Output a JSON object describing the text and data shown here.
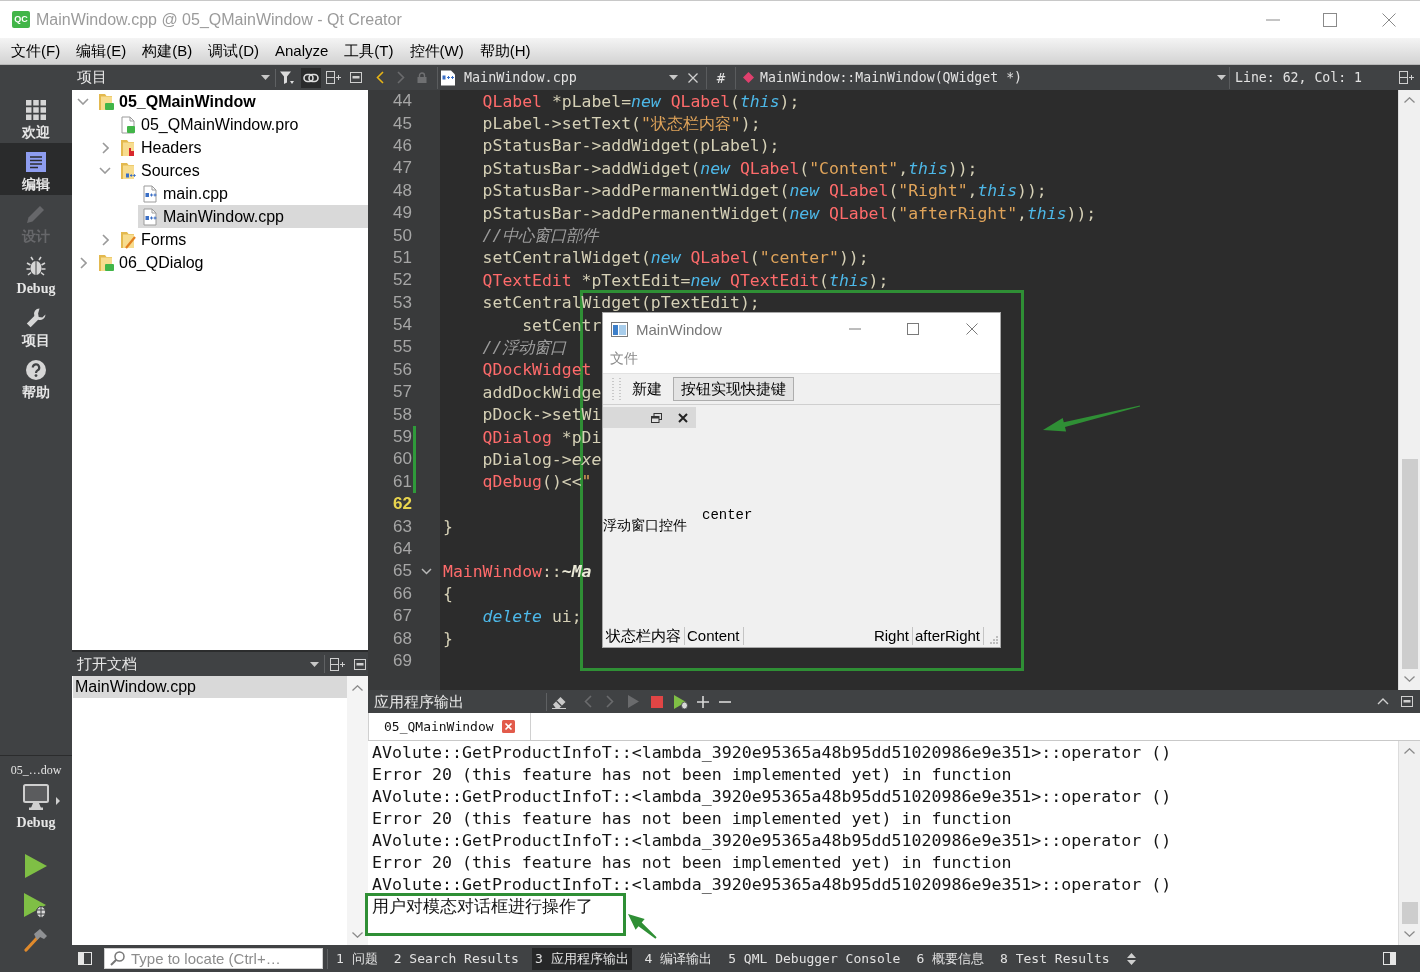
{
  "window": {
    "logo": "QC",
    "title": "MainWindow.cpp @ 05_QMainWindow - Qt Creator"
  },
  "menu_bar": [
    "文件(F)",
    "编辑(E)",
    "构建(B)",
    "调试(D)",
    "Analyze",
    "工具(T)",
    "控件(W)",
    "帮助(H)"
  ],
  "mode_bar": {
    "items": [
      {
        "kind": "grid",
        "label": "欢迎",
        "selected": false,
        "disabled": false
      },
      {
        "kind": "document",
        "label": "编辑",
        "selected": true,
        "disabled": false
      },
      {
        "kind": "pencil",
        "label": "设计",
        "selected": false,
        "disabled": true
      },
      {
        "kind": "bug",
        "label": "Debug",
        "selected": false,
        "disabled": false
      },
      {
        "kind": "wrench",
        "label": "项目",
        "selected": false,
        "disabled": false
      },
      {
        "kind": "help",
        "label": "帮助",
        "selected": false,
        "disabled": false
      }
    ],
    "target": {
      "project": "05_…dow",
      "config": "Debug"
    }
  },
  "projects_panel": {
    "title": "项目",
    "synchronize": true,
    "tree": [
      {
        "label": "05_QMainWindow",
        "kind": "project",
        "active": true,
        "expanded": true,
        "selected": false,
        "children": [
          {
            "label": "05_QMainWindow.pro",
            "kind": "profile",
            "selected": false
          },
          {
            "label": "Headers",
            "kind": "headers",
            "expanded": false,
            "selected": false
          },
          {
            "label": "Sources",
            "kind": "sources",
            "expanded": true,
            "selected": false,
            "children": [
              {
                "label": "main.cpp",
                "kind": "cppfile",
                "selected": false
              },
              {
                "label": "MainWindow.cpp",
                "kind": "cppfile",
                "selected": true
              }
            ]
          },
          {
            "label": "Forms",
            "kind": "forms",
            "expanded": false,
            "selected": false
          }
        ]
      },
      {
        "label": "06_QDialog",
        "kind": "project",
        "active": false,
        "expanded": false,
        "selected": false
      }
    ]
  },
  "open_documents": {
    "title": "打开文档",
    "items": [
      {
        "label": "MainWindow.cpp",
        "selected": true
      }
    ]
  },
  "editor": {
    "can_go_back": true,
    "can_go_forward": false,
    "file": "MainWindow.cpp",
    "hash": "#",
    "symbol": "MainWindow::MainWindow(QWidget *)",
    "position": "Line: 62, Col: 1",
    "lines": [
      {
        "number": "44",
        "current": false,
        "modified": false,
        "fold": false,
        "tokens": [
          {
            "kind": "type",
            "text": "    QLabel"
          },
          {
            "kind": "plain",
            "text": " *pLabel="
          },
          {
            "kind": "keyword",
            "text": "new "
          },
          {
            "kind": "type",
            "text": "QLabel"
          },
          {
            "kind": "plain",
            "text": "("
          },
          {
            "kind": "keyword",
            "text": "this"
          },
          {
            "kind": "plain",
            "text": ");"
          }
        ]
      },
      {
        "number": "45",
        "current": false,
        "modified": false,
        "fold": false,
        "tokens": [
          {
            "kind": "plain",
            "text": "    pLabel->setText("
          },
          {
            "kind": "string",
            "text": "\"状态栏内容\""
          },
          {
            "kind": "plain",
            "text": ");"
          }
        ]
      },
      {
        "number": "46",
        "current": false,
        "modified": false,
        "fold": false,
        "tokens": [
          {
            "kind": "plain",
            "text": "    pStatusBar->addWidget(pLabel);"
          }
        ]
      },
      {
        "number": "47",
        "current": false,
        "modified": false,
        "fold": false,
        "tokens": [
          {
            "kind": "plain",
            "text": "    pStatusBar->addWidget("
          },
          {
            "kind": "keyword",
            "text": "new "
          },
          {
            "kind": "type",
            "text": "QLabel"
          },
          {
            "kind": "plain",
            "text": "("
          },
          {
            "kind": "string",
            "text": "\"Content\""
          },
          {
            "kind": "plain",
            "text": ","
          },
          {
            "kind": "keyword",
            "text": "this"
          },
          {
            "kind": "plain",
            "text": "));"
          }
        ]
      },
      {
        "number": "48",
        "current": false,
        "modified": false,
        "fold": false,
        "tokens": [
          {
            "kind": "plain",
            "text": "    pStatusBar->addPermanentWidget("
          },
          {
            "kind": "keyword",
            "text": "new "
          },
          {
            "kind": "type",
            "text": "QLabel"
          },
          {
            "kind": "plain",
            "text": "("
          },
          {
            "kind": "string",
            "text": "\"Right\""
          },
          {
            "kind": "plain",
            "text": ","
          },
          {
            "kind": "keyword",
            "text": "this"
          },
          {
            "kind": "plain",
            "text": "));"
          }
        ]
      },
      {
        "number": "49",
        "current": false,
        "modified": false,
        "fold": false,
        "tokens": [
          {
            "kind": "plain",
            "text": "    pStatusBar->addPermanentWidget("
          },
          {
            "kind": "keyword",
            "text": "new "
          },
          {
            "kind": "type",
            "text": "QLabel"
          },
          {
            "kind": "plain",
            "text": "("
          },
          {
            "kind": "string",
            "text": "\"afterRight\""
          },
          {
            "kind": "plain",
            "text": ","
          },
          {
            "kind": "keyword",
            "text": "this"
          },
          {
            "kind": "plain",
            "text": "));"
          }
        ]
      },
      {
        "number": "50",
        "current": false,
        "modified": false,
        "fold": false,
        "tokens": [
          {
            "kind": "comment",
            "text": "    //中心窗口部件"
          }
        ]
      },
      {
        "number": "51",
        "current": false,
        "modified": false,
        "fold": false,
        "tokens": [
          {
            "kind": "plain",
            "text": "    setCentralWidget("
          },
          {
            "kind": "keyword",
            "text": "new "
          },
          {
            "kind": "type",
            "text": "QLabel"
          },
          {
            "kind": "plain",
            "text": "("
          },
          {
            "kind": "string",
            "text": "\"center\""
          },
          {
            "kind": "plain",
            "text": "));"
          }
        ]
      },
      {
        "number": "52",
        "current": false,
        "modified": false,
        "fold": false,
        "tokens": [
          {
            "kind": "type",
            "text": "    QTextEdit"
          },
          {
            "kind": "plain",
            "text": " *pTextEdit="
          },
          {
            "kind": "keyword",
            "text": "new "
          },
          {
            "kind": "type",
            "text": "QTextEdit"
          },
          {
            "kind": "plain",
            "text": "("
          },
          {
            "kind": "keyword",
            "text": "this"
          },
          {
            "kind": "plain",
            "text": ");"
          }
        ]
      },
      {
        "number": "53",
        "current": false,
        "modified": false,
        "fold": false,
        "tokens": [
          {
            "kind": "plain",
            "text": "    setCentralWidget(pTextEdit);"
          }
        ]
      },
      {
        "number": "54",
        "current": false,
        "modified": false,
        "fold": false,
        "tokens": [
          {
            "kind": "plain",
            "text": "        setCentr"
          }
        ]
      },
      {
        "number": "55",
        "current": false,
        "modified": false,
        "fold": false,
        "tokens": [
          {
            "kind": "comment",
            "text": "    //浮动窗口"
          }
        ]
      },
      {
        "number": "56",
        "current": false,
        "modified": false,
        "fold": false,
        "tokens": [
          {
            "kind": "type",
            "text": "    QDockWidget"
          }
        ]
      },
      {
        "number": "57",
        "current": false,
        "modified": false,
        "fold": false,
        "tokens": [
          {
            "kind": "plain",
            "text": "    addDockWidge"
          }
        ]
      },
      {
        "number": "58",
        "current": false,
        "modified": false,
        "fold": false,
        "tokens": [
          {
            "kind": "plain",
            "text": "    pDock->setWi"
          }
        ]
      },
      {
        "number": "59",
        "current": false,
        "modified": true,
        "fold": false,
        "tokens": [
          {
            "kind": "type",
            "text": "    QDialog"
          },
          {
            "kind": "plain",
            "text": " *pDi"
          }
        ]
      },
      {
        "number": "60",
        "current": false,
        "modified": true,
        "fold": false,
        "tokens": [
          {
            "kind": "plain",
            "text": "    pDialog->"
          },
          {
            "kind": "virtual",
            "text": "exe"
          }
        ]
      },
      {
        "number": "61",
        "current": false,
        "modified": true,
        "fold": false,
        "tokens": [
          {
            "kind": "type",
            "text": "    qDebug"
          },
          {
            "kind": "plain",
            "text": "()<<"
          },
          {
            "kind": "string",
            "text": "\""
          }
        ]
      },
      {
        "number": "62",
        "current": true,
        "modified": false,
        "fold": false
      },
      {
        "number": "63",
        "current": false,
        "modified": false,
        "fold": false,
        "tokens": [
          {
            "kind": "plain",
            "text": "}"
          }
        ]
      },
      {
        "number": "64",
        "current": false,
        "modified": false,
        "fold": false
      },
      {
        "number": "65",
        "current": false,
        "modified": false,
        "fold": true,
        "tokens": [
          {
            "kind": "type",
            "text": "MainWindow"
          },
          {
            "kind": "plain",
            "text": "::"
          },
          {
            "kind": "function",
            "text": "~Ma"
          }
        ]
      },
      {
        "number": "66",
        "current": false,
        "modified": false,
        "fold": false,
        "tokens": [
          {
            "kind": "plain",
            "text": "{"
          }
        ]
      },
      {
        "number": "67",
        "current": false,
        "modified": false,
        "fold": false,
        "tokens": [
          {
            "kind": "keyword",
            "text": "    delete"
          },
          {
            "kind": "plain",
            "text": " ui;"
          }
        ]
      },
      {
        "number": "68",
        "current": false,
        "modified": false,
        "fold": false,
        "tokens": [
          {
            "kind": "plain",
            "text": "}"
          }
        ]
      },
      {
        "number": "69",
        "current": false,
        "modified": false,
        "fold": false
      }
    ]
  },
  "app_window": {
    "title": "MainWindow",
    "menu": [
      "文件"
    ],
    "toolbar": [
      {
        "label": "新建",
        "hovered": false
      },
      {
        "label": "按钮实现快捷键",
        "hovered": true
      }
    ],
    "dock": {
      "label": "浮动窗口控件"
    },
    "central_label": "center",
    "status_bar": {
      "messages": [
        "状态栏内容",
        "Content"
      ],
      "permanent": [
        "Right",
        "afterRight"
      ]
    }
  },
  "output_panel": {
    "title": "应用程序输出",
    "tabs": [
      {
        "label": "05_QMainWindow",
        "selected": true
      }
    ],
    "lines": [
      "AVolute::GetProductInfoT::<lambda_3920e95365a48b95dd51020986e9e351>::operator ()",
      "Error 20 (this feature has not been implemented yet) in function",
      "AVolute::GetProductInfoT::<lambda_3920e95365a48b95dd51020986e9e351>::operator ()",
      "Error 20 (this feature has not been implemented yet) in function",
      "AVolute::GetProductInfoT::<lambda_3920e95365a48b95dd51020986e9e351>::operator ()",
      "Error 20 (this feature has not been implemented yet) in function",
      "AVolute::GetProductInfoT::<lambda_3920e95365a48b95dd51020986e9e351>::operator ()",
      "用户对模态对话框进行操作了"
    ]
  },
  "status_bar": {
    "locator": {
      "placeholder": "Type to locate (Ctrl+…"
    },
    "panes": [
      {
        "label": "1 问题",
        "selected": false
      },
      {
        "label": "2 Search Results",
        "selected": false
      },
      {
        "label": "3 应用程序输出",
        "selected": true
      },
      {
        "label": "4 编译输出",
        "selected": false
      },
      {
        "label": "5 QML Debugger Console",
        "selected": false
      },
      {
        "label": "6 概要信息",
        "selected": false
      },
      {
        "label": "8 Test Results",
        "selected": false
      }
    ]
  }
}
